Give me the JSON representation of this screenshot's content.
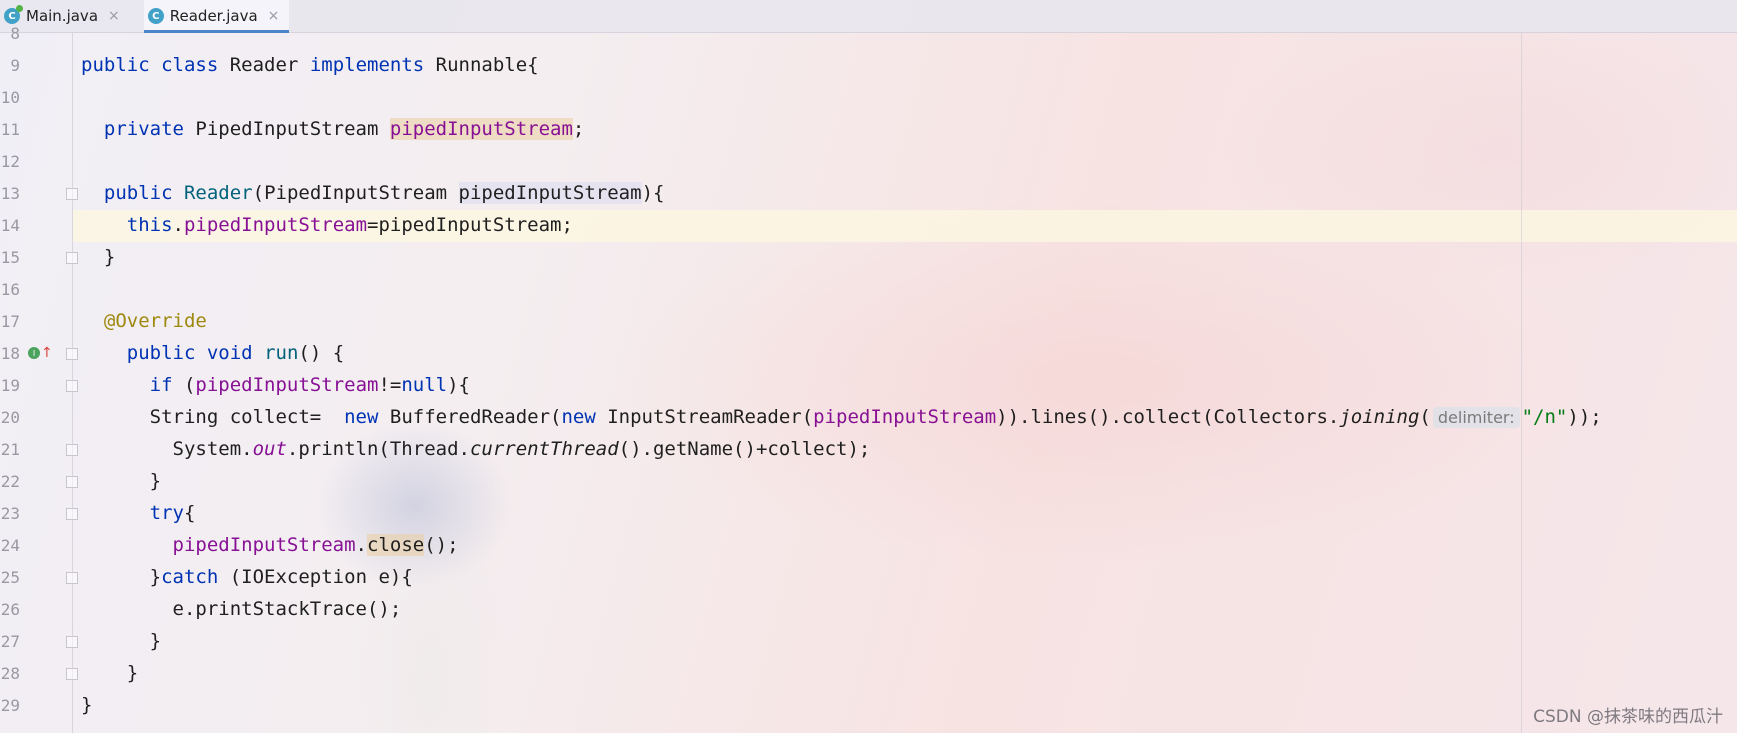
{
  "tabs": [
    {
      "label": "Main.java",
      "icon": "class-icon",
      "close": "×",
      "active": false
    },
    {
      "label": "Reader.java",
      "icon": "class-icon",
      "close": "×",
      "active": true
    }
  ],
  "gutter": {
    "line_numbers": [
      "8",
      "9",
      "10",
      "11",
      "12",
      "13",
      "14",
      "15",
      "16",
      "17",
      "18",
      "19",
      "20",
      "21",
      "22",
      "23",
      "24",
      "25",
      "26",
      "27",
      "28",
      "29"
    ],
    "override_icon_letter": "I"
  },
  "code": {
    "l9": {
      "public": "public",
      "class": "class",
      "name": " Reader ",
      "implements": "implements",
      "rest": " Runnable{"
    },
    "l11": {
      "private": "private",
      "type": " PipedInputStream ",
      "field": "pipedInputStream",
      "semi": ";"
    },
    "l13": {
      "public": "public",
      "ctor": "Reader",
      "open": "(PipedInputStream ",
      "param": "pipedInputStream",
      "close": "){"
    },
    "l14": {
      "this": "this",
      "dot": ".",
      "field": "pipedInputStream",
      "assign": "=pipedInputStream;"
    },
    "l15": "}",
    "l17": "@Override",
    "l18": {
      "public": "public",
      "void": "void",
      "run": "run",
      "rest": "() {"
    },
    "l19": {
      "if": "if",
      "open": " (",
      "field": "pipedInputStream",
      "neq": "!=",
      "null": "null",
      "close": "){"
    },
    "l20": {
      "decl": "String collect=  ",
      "new1": "new",
      "buf": " BufferedReader(",
      "new2": "new",
      "isr": " InputStreamReader(",
      "field": "pipedInputStream",
      "chain": ")).lines().collect(Collectors.",
      "joining": "joining",
      "paren": "(",
      "hint": "delimiter:",
      "str": "\"/n\"",
      "end": "));"
    },
    "l21": {
      "sys": "System.",
      "out": "out",
      "println": ".println(Thread.",
      "current": "currentThread",
      "rest": "().getName()+collect);"
    },
    "l22": "}",
    "l23": {
      "try": "try",
      "brace": "{"
    },
    "l24": {
      "field": "pipedInputStream",
      "dot": ".",
      "close": "close",
      "rest": "();"
    },
    "l25": {
      "brace": "}",
      "catch": "catch",
      "rest": " (IOException e){"
    },
    "l26": "e.printStackTrace();",
    "l27": "}",
    "l28": "}",
    "l29": "}"
  },
  "watermark": "CSDN @抹茶味的西瓜汁",
  "colors": {
    "keyword": "#0033b3",
    "field": "#871094",
    "annotation": "#9e880d",
    "string": "#067d17",
    "method": "#00627a",
    "tab_accent": "#4a86c8"
  }
}
